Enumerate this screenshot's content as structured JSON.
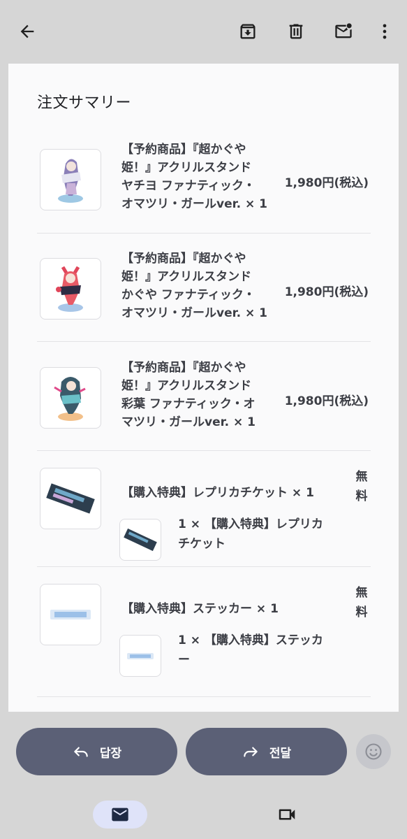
{
  "section": {
    "title": "注文サマリー"
  },
  "items": [
    {
      "title_lines": [
        "【予約商品】『超かぐや",
        "姫！』アクリルスタンド",
        "ヤチヨ ファナティック・",
        "オマツリ・ガールver. × 1"
      ],
      "price": "1,980円(税込)"
    },
    {
      "title_lines": [
        "【予約商品】『超かぐや",
        "姫！』アクリルスタンド",
        "かぐや ファナティック・",
        "オマツリ・ガールver. × 1"
      ],
      "price": "1,980円(税込)"
    },
    {
      "title_lines": [
        "【予約商品】『超かぐや",
        "姫！』アクリルスタンド",
        "彩葉 ファナティック・オ",
        "マツリ・ガールver. × 1"
      ],
      "price": "1,980円(税込)"
    }
  ],
  "bonus": [
    {
      "title": "【購入特典】レプリカチケット × 1",
      "free_lines": [
        "無",
        "料"
      ],
      "sub_lines": [
        "1 × 【購入特典】レプリカ",
        "チケット"
      ]
    },
    {
      "title": "【購入特典】ステッカー × 1",
      "free_lines": [
        "無",
        "料"
      ],
      "sub_lines": [
        "1 × 【購入特典】ステッカ",
        "ー"
      ]
    }
  ],
  "actions": {
    "reply_label": "답장",
    "forward_label": "전달"
  },
  "icons": {
    "back": "arrow-back-icon",
    "archive": "archive-icon",
    "delete": "trash-icon",
    "unread": "mark-unread-icon",
    "more": "more-vert-icon",
    "reply": "reply-icon",
    "forward": "forward-icon",
    "emoji": "emoji-icon",
    "mail": "mail-icon",
    "video": "video-camera-icon"
  },
  "colors": {
    "action_button": "#5b6076",
    "nav_active": "#dfe3f9",
    "background": "#d6d6d6"
  }
}
